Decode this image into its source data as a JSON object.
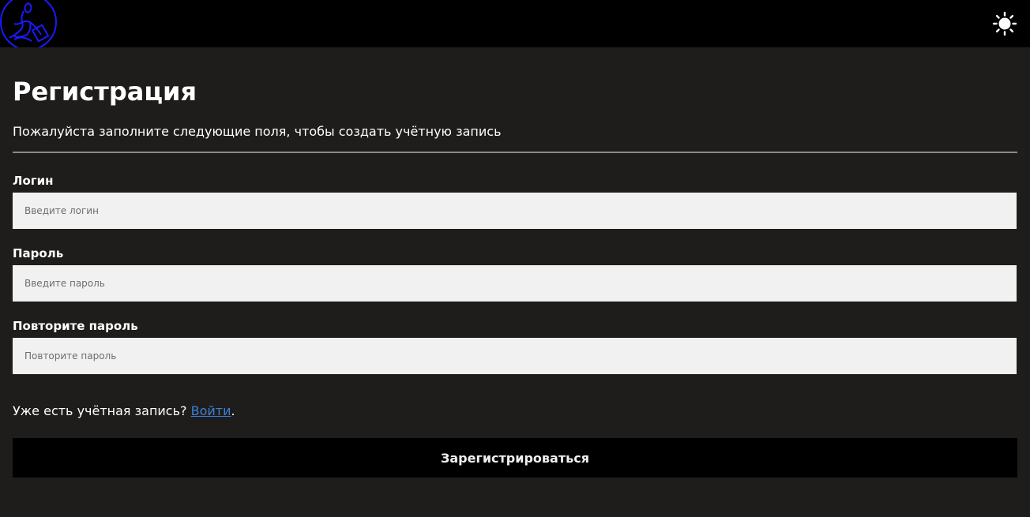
{
  "header": {
    "logo_icon": "goddess-outline-logo-icon",
    "logo_color": "#1a1aff",
    "theme_toggle_icon": "sun-icon"
  },
  "form": {
    "title": "Регистрация",
    "subtitle": "Пожалуйста заполните следующие поля, чтобы создать учётную запись",
    "fields": [
      {
        "label": "Логин",
        "placeholder": "Введите логин",
        "value": ""
      },
      {
        "label": "Пароль",
        "placeholder": "Введите пароль",
        "value": ""
      },
      {
        "label": "Повторите пароль",
        "placeholder": "Повторите пароль",
        "value": ""
      }
    ],
    "login_prompt": "Уже есть учётная запись?",
    "login_link": "Войти",
    "login_suffix": ".",
    "submit_label": "Зарегистрироваться"
  },
  "colors": {
    "page_background": "#1e1d1c",
    "header_background": "#000000",
    "input_background": "#f1f1f1",
    "link": "#3d7fd6",
    "button_background": "#000000"
  }
}
